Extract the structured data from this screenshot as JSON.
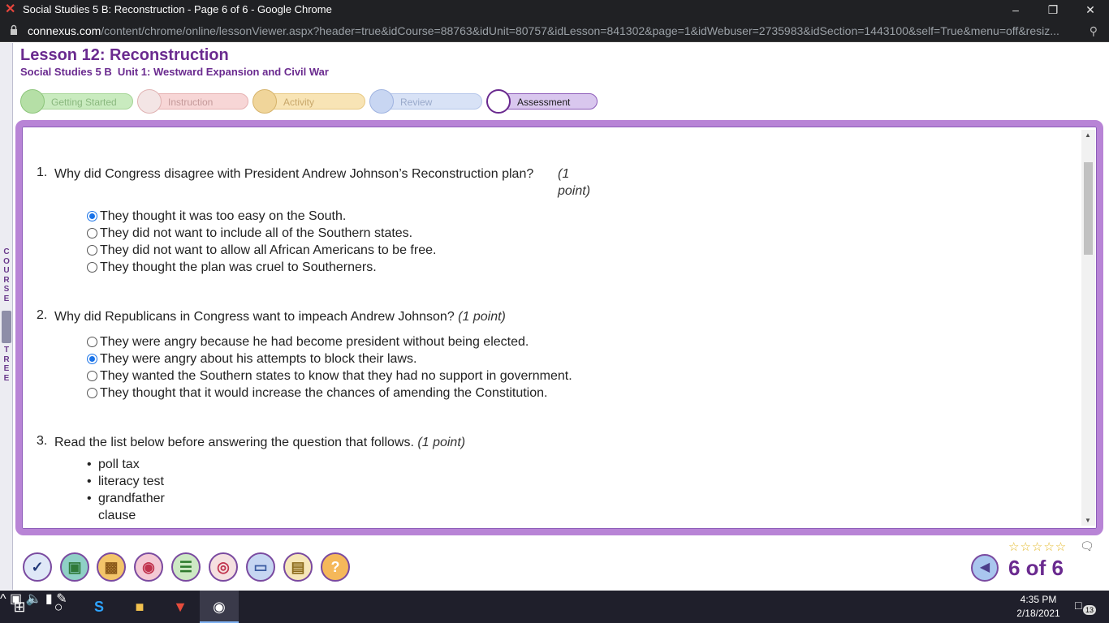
{
  "browser": {
    "tab_title": "Social Studies 5 B: Reconstruction - Page 6 of 6 - Google Chrome",
    "url_host": "connexus.com",
    "url_path": "/content/chrome/online/lessonViewer.aspx?header=true&idCourse=88763&idUnit=80757&idLesson=841302&page=1&idWebuser=2735983&idSection=1443100&self=True&menu=off&resiz..."
  },
  "lesson": {
    "title": "Lesson 12: Reconstruction",
    "subtitle": "Social Studies 5 B  Unit 1: Westward Expansion and Civil War"
  },
  "course_tree": {
    "letters": [
      "C",
      "O",
      "U",
      "R",
      "S",
      "E",
      "",
      "T",
      "R",
      "E",
      "E"
    ]
  },
  "phases": [
    {
      "label": "Getting Started"
    },
    {
      "label": "Instruction"
    },
    {
      "label": "Activity"
    },
    {
      "label": "Review"
    },
    {
      "label": "Assessment"
    }
  ],
  "questions": [
    {
      "number": "1.",
      "text": "Why did Congress disagree with President Andrew Johnson’s Reconstruction plan?",
      "points": "(1 point)",
      "options": [
        {
          "text": "They thought it was too easy on the South.",
          "selected": true
        },
        {
          "text": "They did not want to include all of the Southern states.",
          "selected": false
        },
        {
          "text": "They did not want to allow all African Americans to be free.",
          "selected": false
        },
        {
          "text": "They thought the plan was cruel to Southerners.",
          "selected": false
        }
      ]
    },
    {
      "number": "2.",
      "text": "Why did Republicans in Congress want to impeach Andrew Johnson?",
      "points": "(1 point)",
      "options": [
        {
          "text": "They were angry because he had become president without being elected.",
          "selected": false
        },
        {
          "text": "They were angry about his attempts to block their laws.",
          "selected": true
        },
        {
          "text": "They wanted the Southern states to know that they had no support in government.",
          "selected": false
        },
        {
          "text": "They thought that it would increase the chances of amending the Constitution.",
          "selected": false
        }
      ]
    },
    {
      "number": "3.",
      "text": "Read the list below before answering the question that follows.",
      "points": "(1 point)",
      "bullets": [
        "poll tax",
        "literacy test",
        "grandfather clause"
      ]
    }
  ],
  "pager": {
    "current_label": "6 of 6"
  },
  "taskbar": {
    "time": "4:35 PM",
    "date": "2/18/2021",
    "notification_count": "13"
  },
  "colors": {
    "accent_purple": "#6a2a8f",
    "frame_purple": "#b884d6",
    "radio_blue": "#1a73e8"
  }
}
